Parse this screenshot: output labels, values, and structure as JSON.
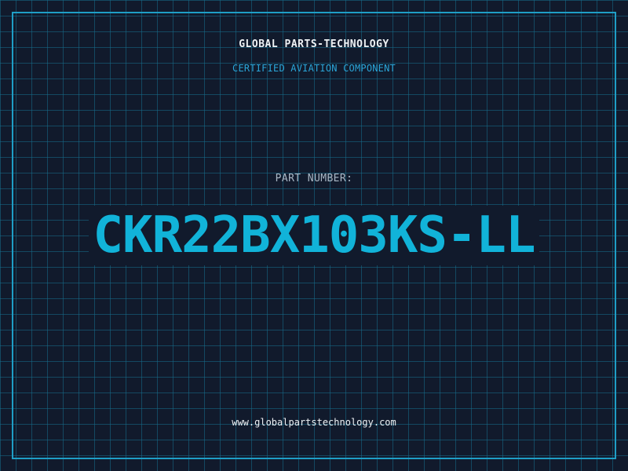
{
  "header": {
    "company_name": "GLOBAL PARTS-TECHNOLOGY",
    "tagline": "CERTIFIED AVIATION COMPONENT"
  },
  "part": {
    "label": "PART NUMBER:",
    "number": "CKR22BX103KS-LL"
  },
  "footer": {
    "website": "www.globalpartstechnology.com"
  },
  "colors": {
    "background": "#111a2c",
    "grid": "#166e8c",
    "accent": "#11b3d9",
    "frame": "#1f9ec6",
    "text": "#eef2f5"
  }
}
